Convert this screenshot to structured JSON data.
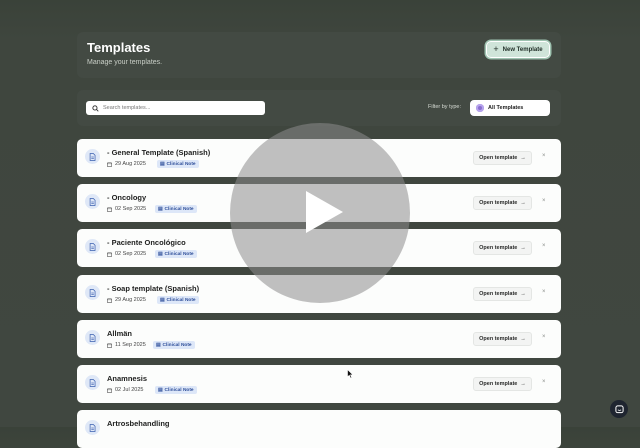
{
  "header": {
    "title": "Templates",
    "subtitle": "Manage your templates.",
    "new_button_label": "New Template"
  },
  "filters": {
    "search_placeholder": "Search templates...",
    "filter_label": "Filter by type:",
    "filter_value": "All Templates"
  },
  "templates": [
    {
      "title": "- General Template (Spanish)",
      "date": "29 Aug 2025",
      "badge": "Clinical Note",
      "open_label": "Open template"
    },
    {
      "title": "- Oncology",
      "date": "02 Sep 2025",
      "badge": "Clinical Note",
      "open_label": "Open template"
    },
    {
      "title": "- Paciente Oncológico",
      "date": "02 Sep 2025",
      "badge": "Clinical Note",
      "open_label": "Open template"
    },
    {
      "title": "- Soap template (Spanish)",
      "date": "29 Aug 2025",
      "badge": "Clinical Note",
      "open_label": "Open template"
    },
    {
      "title": "Allmän",
      "date": "11 Sep 2025",
      "badge": "Clinical Note",
      "open_label": "Open template"
    },
    {
      "title": "Anamnesis",
      "date": "02 Jul 2025",
      "badge": "Clinical Note",
      "open_label": "Open template"
    },
    {
      "title": "Artrosbehandling",
      "date": "",
      "badge": "",
      "open_label": ""
    }
  ],
  "colors": {
    "background": "#404740",
    "panel": "#434a43",
    "accent_button": "#cfe4d9",
    "badge_bg": "#dde7f8",
    "badge_text": "#2f4f9a",
    "filter_dot": "#8a6fd0"
  },
  "icons": {
    "search": "search-icon",
    "calendar": "calendar-icon",
    "document": "document-icon",
    "play": "play-icon",
    "chat": "chat-icon"
  }
}
